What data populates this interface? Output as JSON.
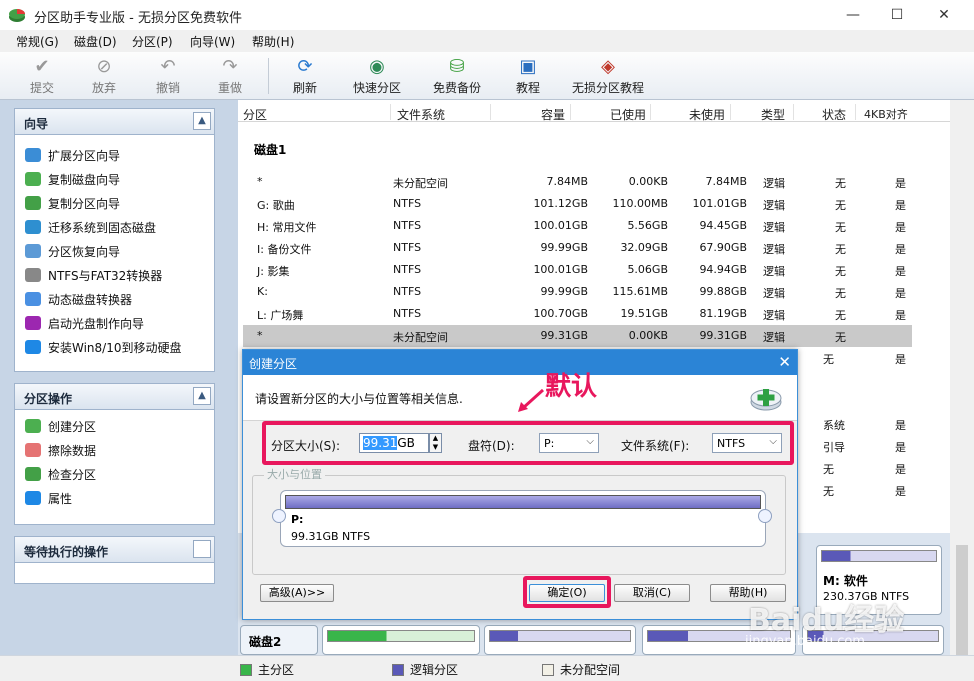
{
  "window": {
    "title": "分区助手专业版 - 无损分区免费软件"
  },
  "menu": [
    "常规(G)",
    "磁盘(D)",
    "分区(P)",
    "向导(W)",
    "帮助(H)"
  ],
  "toolbar": {
    "commit": "提交",
    "discard": "放弃",
    "undo": "撤销",
    "redo": "重做",
    "refresh": "刷新",
    "quick_partition": "快速分区",
    "free_backup": "免费备份",
    "tutorial": "教程",
    "lossless_tutorial": "无损分区教程"
  },
  "wizard_panel": {
    "title": "向导",
    "items": [
      "扩展分区向导",
      "复制磁盘向导",
      "复制分区向导",
      "迁移系统到固态磁盘",
      "分区恢复向导",
      "NTFS与FAT32转换器",
      "动态磁盘转换器",
      "启动光盘制作向导",
      "安装Win8/10到移动硬盘"
    ]
  },
  "ops_panel": {
    "title": "分区操作",
    "items": [
      "创建分区",
      "擦除数据",
      "检查分区",
      "属性"
    ]
  },
  "pending_panel": {
    "title": "等待执行的操作"
  },
  "table": {
    "headers": [
      "分区",
      "文件系统",
      "容量",
      "已使用",
      "未使用",
      "类型",
      "状态",
      "4KB对齐"
    ],
    "disk1_label": "磁盘1",
    "rows": [
      {
        "name": "*",
        "fs": "未分配空间",
        "cap": "7.84MB",
        "used": "0.00KB",
        "free": "7.84MB",
        "type": "逻辑",
        "status": "无",
        "align": "是"
      },
      {
        "name": "G: 歌曲",
        "fs": "NTFS",
        "cap": "101.12GB",
        "used": "110.00MB",
        "free": "101.01GB",
        "type": "逻辑",
        "status": "无",
        "align": "是"
      },
      {
        "name": "H: 常用文件",
        "fs": "NTFS",
        "cap": "100.01GB",
        "used": "5.56GB",
        "free": "94.45GB",
        "type": "逻辑",
        "status": "无",
        "align": "是"
      },
      {
        "name": "I: 备份文件",
        "fs": "NTFS",
        "cap": "99.99GB",
        "used": "32.09GB",
        "free": "67.90GB",
        "type": "逻辑",
        "status": "无",
        "align": "是"
      },
      {
        "name": "J: 影集",
        "fs": "NTFS",
        "cap": "100.01GB",
        "used": "5.06GB",
        "free": "94.94GB",
        "type": "逻辑",
        "status": "无",
        "align": "是"
      },
      {
        "name": "K:",
        "fs": "NTFS",
        "cap": "99.99GB",
        "used": "115.61MB",
        "free": "99.88GB",
        "type": "逻辑",
        "status": "无",
        "align": "是"
      },
      {
        "name": "L: 广场舞",
        "fs": "NTFS",
        "cap": "100.70GB",
        "used": "19.51GB",
        "free": "81.19GB",
        "type": "逻辑",
        "status": "无",
        "align": "是"
      },
      {
        "name": "*",
        "fs": "未分配空间",
        "cap": "99.31GB",
        "used": "0.00KB",
        "free": "99.31GB",
        "type": "逻辑",
        "status": "无",
        "align": ""
      }
    ],
    "hidden_rows": [
      {
        "status": "无",
        "align": "是"
      },
      {
        "status": "系统",
        "align": "是"
      },
      {
        "status": "引导",
        "align": "是"
      },
      {
        "status": "无",
        "align": "是"
      },
      {
        "status": "无",
        "align": "是"
      }
    ]
  },
  "diskmap": {
    "m_label": "M: 软件",
    "m_size": "230.37GB NTFS",
    "disk2_label": "磁盘2"
  },
  "dialog": {
    "title": "创建分区",
    "info": "请设置新分区的大小与位置等相关信息.",
    "size_label": "分区大小(S):",
    "size_value": "99.31",
    "size_unit": "GB",
    "drive_label": "盘符(D):",
    "drive_value": "P:",
    "fs_label": "文件系统(F):",
    "fs_value": "NTFS",
    "group_label": "大小与位置",
    "partition_label": "P:",
    "partition_info": "99.31GB NTFS",
    "advanced_button": "高级(A)>>",
    "ok_button": "确定(O)",
    "cancel_button": "取消(C)",
    "help_button": "帮助(H)"
  },
  "annotation": {
    "text": "默认"
  },
  "legend": [
    "主分区",
    "逻辑分区",
    "未分配空间"
  ],
  "watermark": {
    "text": "Baidu经验",
    "sub": "jingyan.baidu.com"
  },
  "colors": {
    "primary": "#39b54a",
    "logical": "#5a59b8",
    "unallocated": "#f2f0e6",
    "accent": "#2b84d6",
    "highlight": "#e8175d"
  }
}
